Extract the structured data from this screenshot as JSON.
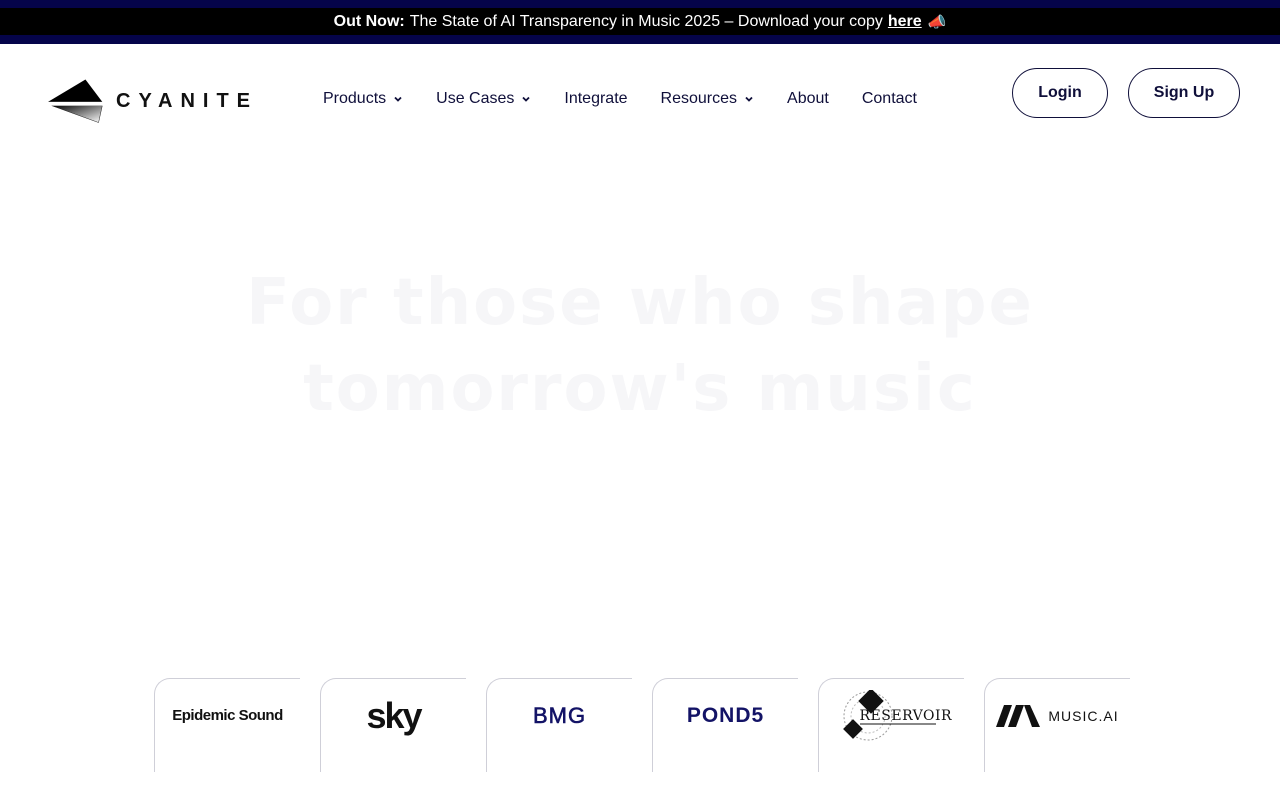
{
  "announcement": {
    "lead": "Out Now:",
    "text": "The State of AI Transparency in Music 2025 – Download your copy",
    "link": "here",
    "emoji": "📣"
  },
  "logo": {
    "text": "CYANITE"
  },
  "nav": {
    "items": [
      {
        "label": "Products",
        "has_dropdown": true
      },
      {
        "label": "Use Cases",
        "has_dropdown": true
      },
      {
        "label": "Integrate",
        "has_dropdown": false
      },
      {
        "label": "Resources",
        "has_dropdown": true
      },
      {
        "label": "About",
        "has_dropdown": false
      },
      {
        "label": "Contact",
        "has_dropdown": false
      }
    ]
  },
  "auth": {
    "login_label": "Login",
    "signup_label": "Sign Up"
  },
  "hero": {
    "line1": "For those who shape",
    "line2": "tomorrow's music"
  },
  "partners": {
    "epidemic": "Epidemic Sound",
    "sky": "sky",
    "bmg": "BMG",
    "pond5": "POND5",
    "reservoir": "RESERVOIR",
    "musicai": "MUSIC.AI"
  },
  "colors": {
    "navy": "#05044a",
    "text": "#0f0f3a",
    "hero_text": "#f6f6f8",
    "border": "#cfcfd8"
  }
}
